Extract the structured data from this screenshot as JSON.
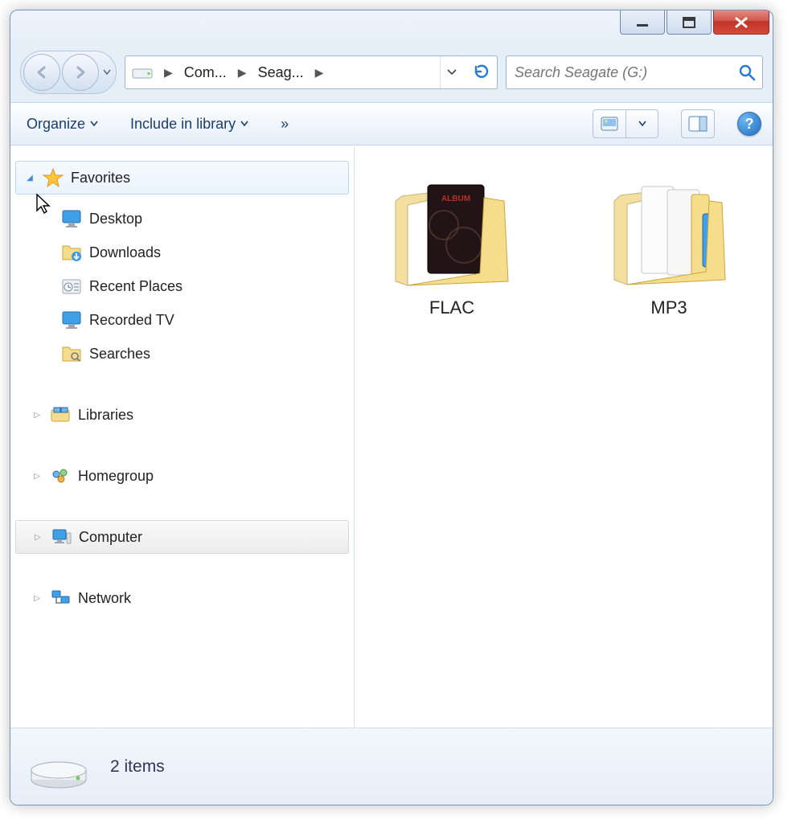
{
  "window_controls": {
    "min": "minimize",
    "max": "maximize",
    "close": "close"
  },
  "breadcrumb": {
    "items": [
      {
        "label": "Com..."
      },
      {
        "label": "Seag..."
      }
    ]
  },
  "search": {
    "placeholder": "Search Seagate (G:)"
  },
  "toolbar": {
    "organize": "Organize",
    "include_library": "Include in library",
    "overflow": "»"
  },
  "navpane": {
    "favorites": {
      "label": "Favorites",
      "children": [
        {
          "label": "Desktop",
          "icon": "monitor-icon"
        },
        {
          "label": "Downloads",
          "icon": "folder-download-icon"
        },
        {
          "label": "Recent Places",
          "icon": "recent-icon"
        },
        {
          "label": "Recorded TV",
          "icon": "monitor-icon"
        },
        {
          "label": "Searches",
          "icon": "folder-search-icon"
        }
      ]
    },
    "libraries": {
      "label": "Libraries"
    },
    "homegroup": {
      "label": "Homegroup"
    },
    "computer": {
      "label": "Computer"
    },
    "network": {
      "label": "Network"
    }
  },
  "content": {
    "folders": [
      {
        "name": "FLAC",
        "preview": true
      },
      {
        "name": "MP3",
        "preview": false
      }
    ]
  },
  "status": {
    "text": "2 items"
  }
}
